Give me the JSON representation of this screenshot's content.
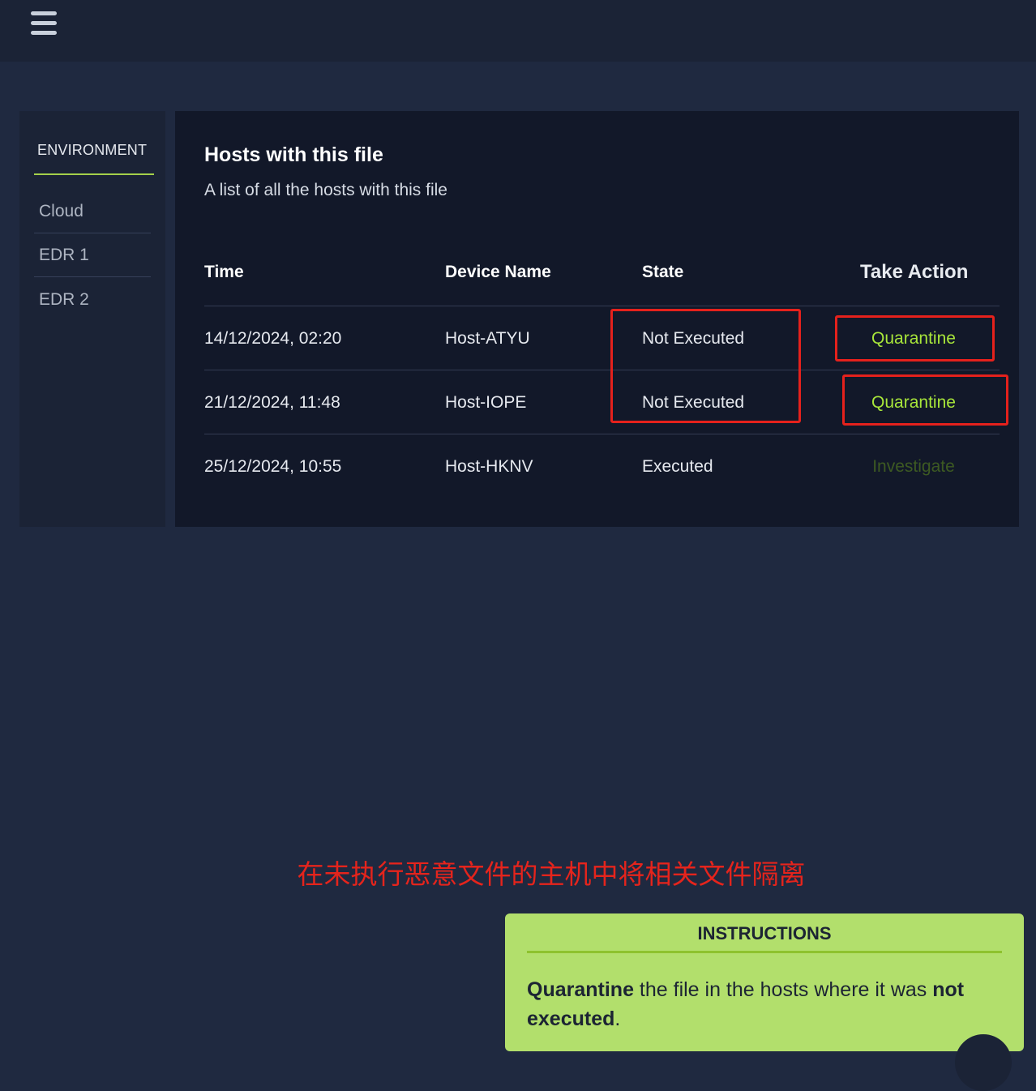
{
  "nav": {
    "menu_icon": "hamburger-menu-icon"
  },
  "sidebar": {
    "title": "ENVIRONMENT",
    "items": [
      {
        "label": "Cloud"
      },
      {
        "label": "EDR 1"
      },
      {
        "label": "EDR 2"
      }
    ]
  },
  "panel": {
    "title": "Hosts with this file",
    "subtitle": "A list of all the hosts with this file",
    "columns": {
      "time": "Time",
      "device": "Device Name",
      "state": "State",
      "action": "Take Action"
    },
    "rows": [
      {
        "time": "14/12/2024, 02:20",
        "device": "Host-ATYU",
        "state": "Not Executed",
        "action": "Quarantine"
      },
      {
        "time": "21/12/2024, 11:48",
        "device": "Host-IOPE",
        "state": "Not Executed",
        "action": "Quarantine"
      },
      {
        "time": "25/12/2024, 10:55",
        "device": "Host-HKNV",
        "state": "Executed",
        "action": "Investigate"
      }
    ]
  },
  "annotation": "在未执行恶意文件的主机中将相关文件隔离",
  "instructions": {
    "title": "INSTRUCTIONS",
    "b1": "Quarantine",
    "t1": " the file in the hosts where it was ",
    "b2": "not executed",
    "t2": "."
  },
  "colors": {
    "accent": "#a4d04a",
    "quarantine": "#a8e63a",
    "investigate": "#3d5a22",
    "highlight": "#e5211c",
    "instructions_bg": "#b2df6c"
  }
}
